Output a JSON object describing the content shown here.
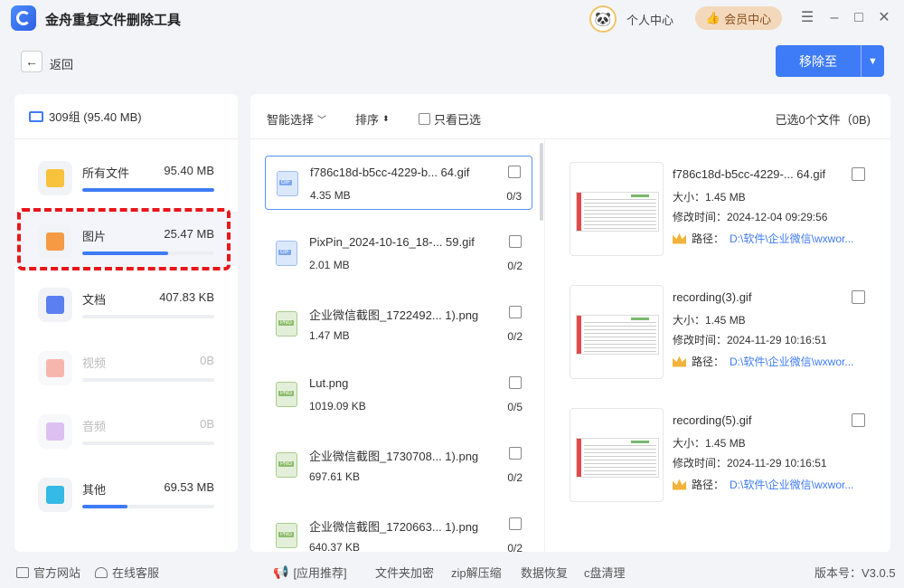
{
  "app": {
    "title": "金舟重复文件删除工具"
  },
  "header": {
    "personal_center": "个人中心",
    "vip_center": "会员中心"
  },
  "nav": {
    "back_label": "返回"
  },
  "actions": {
    "move_to_label": "移除至"
  },
  "summary": {
    "label": "309组 (95.40 MB)"
  },
  "categories": [
    {
      "name": "所有文件",
      "size": "95.40 MB",
      "fill_fraction": 1.0,
      "icon": "folder-icon",
      "color": "#f7c23c",
      "dim": false
    },
    {
      "name": "图片",
      "size": "25.47 MB",
      "fill_fraction": 0.65,
      "icon": "image-icon",
      "color": "#f59a45",
      "dim": false
    },
    {
      "name": "文档",
      "size": "407.83 KB",
      "fill_fraction": 0.0,
      "icon": "document-icon",
      "color": "#5b7ef0",
      "dim": false
    },
    {
      "name": "视频",
      "size": "0B",
      "fill_fraction": 0.0,
      "icon": "video-icon",
      "color": "#f27b6b",
      "dim": true
    },
    {
      "name": "音频",
      "size": "0B",
      "fill_fraction": 0.0,
      "icon": "audio-icon",
      "color": "#c28ee8",
      "dim": true
    },
    {
      "name": "其他",
      "size": "69.53 MB",
      "fill_fraction": 0.34,
      "icon": "other-icon",
      "color": "#35b9e6",
      "dim": false
    }
  ],
  "toolbar": {
    "smart_select": "智能选择",
    "sort": "排序",
    "only_selected": "只看已选",
    "selected_info": "已选0个文件（0B)"
  },
  "files": [
    {
      "name": "f786c18d-b5cc-4229-b... 64.gif",
      "size": "4.35 MB",
      "count": "0/3",
      "type": "GIF"
    },
    {
      "name": "PixPin_2024-10-16_18-... 59.gif",
      "size": "2.01 MB",
      "count": "0/2",
      "type": "GIF"
    },
    {
      "name": "企业微信截图_1722492... 1).png",
      "size": "1.47 MB",
      "count": "0/2",
      "type": "PNG"
    },
    {
      "name": "Lut.png",
      "size": "1019.09 KB",
      "count": "0/5",
      "type": "PNG"
    },
    {
      "name": "企业微信截图_1730708... 1).png",
      "size": "697.61 KB",
      "count": "0/2",
      "type": "PNG"
    },
    {
      "name": "企业微信截图_1720663... 1).png",
      "size": "640.37 KB",
      "count": "0/2",
      "type": "PNG"
    }
  ],
  "duplicates": [
    {
      "name": "f786c18d-b5cc-4229-... 64.gif",
      "size": "大小：1.45 MB",
      "time": "修改时间：2024-12-04 09:29:56",
      "path_label": "路径：",
      "path": "D:\\软件\\企业微信\\wxwor..."
    },
    {
      "name": "recording(3).gif",
      "size": "大小：1.45 MB",
      "time": "修改时间：2024-11-29 10:16:51",
      "path_label": "路径：",
      "path": "D:\\软件\\企业微信\\wxwor..."
    },
    {
      "name": "recording(5).gif",
      "size": "大小：1.45 MB",
      "time": "修改时间：2024-11-29 10:16:51",
      "path_label": "路径：",
      "path": "D:\\软件\\企业微信\\wxwor..."
    }
  ],
  "footer": {
    "official_site": "官方网站",
    "online_service": "在线客服",
    "app_recommend": "[应用推荐]",
    "folder_encrypt": "文件夹加密",
    "zip": "zip解压缩",
    "data_recovery": "数据恢复",
    "c_clean": "c盘清理",
    "version": "版本号：V3.0.5"
  },
  "colors": {
    "accent": "#3e7bf6",
    "highlight": "#e8161b",
    "vip_bg": "#f3d8bb"
  }
}
